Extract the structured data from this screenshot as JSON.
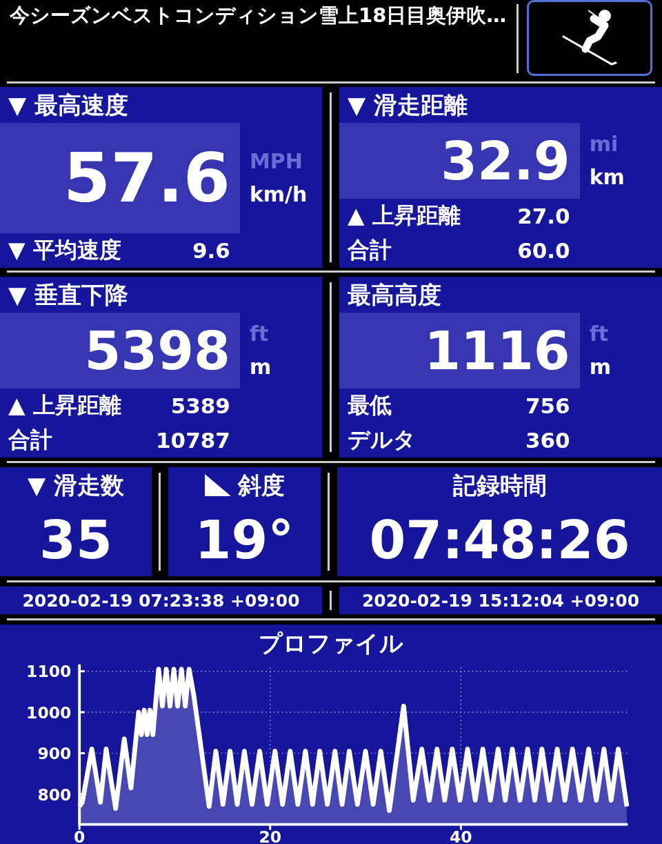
{
  "header": {
    "title": "今シーズンベストコンディション雪上18日目奥伊吹…"
  },
  "panels": [
    {
      "title": "▼ 最高速度",
      "value": "57.6",
      "units": [
        {
          "label": "MPH",
          "selected": false
        },
        {
          "label": "km/h",
          "selected": true
        }
      ],
      "rows": [
        {
          "label": "▼ 平均速度",
          "value": "9.6"
        }
      ]
    },
    {
      "title": "▼ 滑走距離",
      "value": "32.9",
      "units": [
        {
          "label": "mi",
          "selected": false
        },
        {
          "label": "km",
          "selected": true
        }
      ],
      "rows": [
        {
          "label": "▲ 上昇距離",
          "value": "27.0"
        },
        {
          "label": "合計",
          "value": "60.0"
        }
      ]
    },
    {
      "title": "▼ 垂直下降",
      "value": "5398",
      "units": [
        {
          "label": "ft",
          "selected": false
        },
        {
          "label": "m",
          "selected": true
        }
      ],
      "rows": [
        {
          "label": "▲ 上昇距離",
          "value": "5389"
        },
        {
          "label": "合計",
          "value": "10787"
        }
      ]
    },
    {
      "title": "最高高度",
      "value": "1116",
      "units": [
        {
          "label": "ft",
          "selected": false
        },
        {
          "label": "m",
          "selected": true
        }
      ],
      "rows": [
        {
          "label": "最低",
          "value": "756"
        },
        {
          "label": "デルタ",
          "value": "360"
        }
      ]
    }
  ],
  "counters": [
    {
      "kind": "plain",
      "title": "▼ 滑走数",
      "value": "35"
    },
    {
      "kind": "slope",
      "title": "斜度",
      "value": "19°"
    },
    {
      "kind": "plain",
      "title": "記録時間",
      "value": "07:48:26"
    }
  ],
  "times": [
    "2020-02-19 07:23:38 +09:00",
    "2020-02-19 15:12:04 +09:00"
  ],
  "profile": {
    "chart_data": {
      "type": "area",
      "title": "プロファイル",
      "xlim": [
        0,
        57.5
      ],
      "ylim": [
        726,
        1110
      ],
      "xticks": [
        0,
        20,
        40
      ],
      "yticks": [
        800,
        900,
        1000,
        1100
      ],
      "x": [
        0,
        0.3,
        1.3,
        2.2,
        2.8,
        3.8,
        4.7,
        5.4,
        6.2,
        6.5,
        6.8,
        7.1,
        7.4,
        7.7,
        8.3,
        8.7,
        9.1,
        9.5,
        9.9,
        10.3,
        10.7,
        11.1,
        11.5,
        12.0,
        13.6,
        14.3,
        15.05,
        15.8,
        16.55,
        17.3,
        18.1,
        18.9,
        19.7,
        20.5,
        21.3,
        22.1,
        22.9,
        23.7,
        24.45,
        25.2,
        26.0,
        26.8,
        27.55,
        28.3,
        29.15,
        30.0,
        30.8,
        31.6,
        32.5,
        34.0,
        35.0,
        35.9,
        36.7,
        37.5,
        38.3,
        39.1,
        39.9,
        40.7,
        41.5,
        42.3,
        43.1,
        43.9,
        44.65,
        45.4,
        46.2,
        47.0,
        47.75,
        48.5,
        49.3,
        50.1,
        50.9,
        51.7,
        52.55,
        53.4,
        54.2,
        55.0,
        55.75,
        56.5,
        57.4
      ],
      "grid": true,
      "series": [
        {
          "color": "#ffffff",
          "values": [
            770,
            780,
            910,
            780,
            910,
            765,
            935,
            815,
            1000,
            945,
            1005,
            945,
            1005,
            945,
            1105,
            1015,
            1105,
            1015,
            1105,
            1015,
            1105,
            1015,
            1105,
            1040,
            770,
            905,
            775,
            905,
            775,
            905,
            775,
            905,
            775,
            905,
            775,
            905,
            775,
            905,
            775,
            905,
            775,
            905,
            775,
            905,
            775,
            905,
            775,
            905,
            760,
            1015,
            785,
            910,
            785,
            910,
            785,
            910,
            785,
            910,
            785,
            910,
            785,
            910,
            785,
            910,
            785,
            910,
            785,
            910,
            785,
            910,
            785,
            910,
            785,
            910,
            785,
            910,
            785,
            910,
            770
          ]
        }
      ]
    }
  }
}
